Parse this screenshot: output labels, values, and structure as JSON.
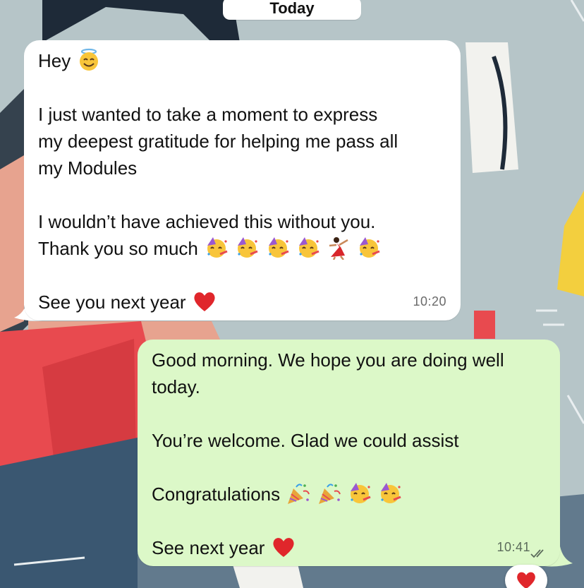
{
  "date_chip": "Today",
  "incoming_message": {
    "line1": "Hey",
    "line2": "I just wanted to take a moment to express",
    "line3": "my deepest gratitude for helping me pass all",
    "line4": "my Modules",
    "line5": "I wouldn’t have achieved this without you.",
    "line6": "Thank you so much",
    "line7": "See you next year",
    "time": "10:20",
    "emojis": [
      "smiling-face-with-halo",
      "partying-face",
      "partying-face",
      "partying-face",
      "partying-face",
      "woman-dancing",
      "partying-face",
      "red-heart"
    ]
  },
  "outgoing_message": {
    "line1": "Good morning. We hope you are doing well",
    "line2": "today.",
    "line3": "You’re welcome. Glad we could assist",
    "line4": "Congratulations",
    "line5": "See next year",
    "time": "10:41",
    "status": "read-double-check",
    "emojis": [
      "party-popper",
      "party-popper",
      "partying-face",
      "partying-face",
      "red-heart"
    ]
  },
  "reaction": "red-heart",
  "colors": {
    "incoming_bubble": "#ffffff",
    "outgoing_bubble": "#dcf8c8",
    "wallpaper": "#b9c7c9",
    "heart": "#e0262b"
  }
}
